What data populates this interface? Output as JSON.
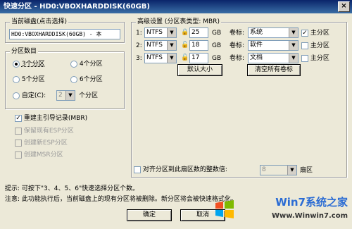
{
  "window": {
    "title": "快速分区 - HD0:VBOXHARDDISK(60GB)",
    "close": "×"
  },
  "disk": {
    "group_title": "当前磁盘(点击选择)",
    "value": "HD0:VBOXHARDDISK(60GB) - 本"
  },
  "count": {
    "group_title": "分区数目",
    "options": [
      "3个分区",
      "4个分区",
      "5个分区",
      "6个分区"
    ],
    "selected": "3个分区",
    "custom_label": "自定(C):",
    "custom_value": "2",
    "custom_suffix": "个分区"
  },
  "options": [
    {
      "label": "重建主引导记录(MBR)",
      "checked": true,
      "enabled": true
    },
    {
      "label": "保留现有ESP分区",
      "checked": false,
      "enabled": false
    },
    {
      "label": "创建新ESP分区",
      "checked": false,
      "enabled": false
    },
    {
      "label": "创建MSR分区",
      "checked": false,
      "enabled": false
    }
  ],
  "advanced": {
    "group_title": "高级设置 (分区表类型: MBR)",
    "rows": [
      {
        "num": "1:",
        "fs": "NTFS",
        "size": "25",
        "unit": "GB",
        "label_caption": "卷标:",
        "label": "系统",
        "primary_label": "主分区",
        "primary": true
      },
      {
        "num": "2:",
        "fs": "NTFS",
        "size": "18",
        "unit": "GB",
        "label_caption": "卷标:",
        "label": "软件",
        "primary_label": "主分区",
        "primary": false
      },
      {
        "num": "3:",
        "fs": "NTFS",
        "size": "17",
        "unit": "GB",
        "label_caption": "卷标:",
        "label": "文档",
        "primary_label": "主分区",
        "primary": false
      }
    ],
    "default_size_button": "默认大小",
    "clear_labels_button": "清空所有卷标",
    "align_label": "对齐分区到此扇区数的整数倍:",
    "align_value": "8",
    "align_unit": "扇区"
  },
  "hints": {
    "tip": "提示: 可按下\"3、4、5、6\"快速选择分区个数。",
    "note": "注意: 此功能执行后，当前磁盘上的现有分区将被删除。新分区将会被快速格式化。"
  },
  "buttons": {
    "ok": "确定",
    "cancel": "取消"
  },
  "watermark": {
    "brand": "Win7系统之家",
    "url": "Www.Winwin7.com"
  }
}
